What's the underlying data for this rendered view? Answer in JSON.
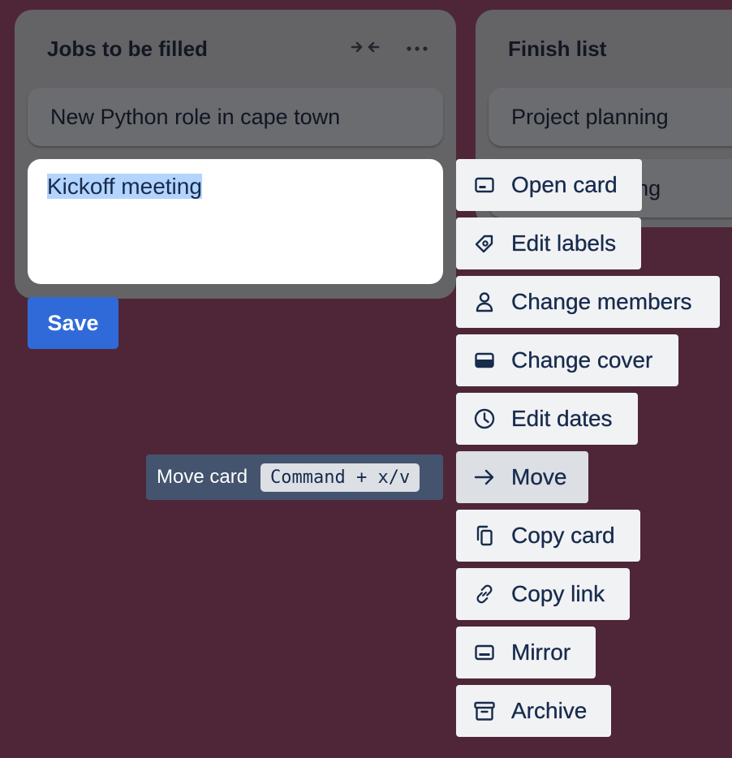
{
  "lists": [
    {
      "title": "Jobs to be filled",
      "cards": [
        "New Python role in cape town"
      ]
    },
    {
      "title": "Finish list",
      "cards": [
        "Project planning",
        "Kickoff meeting"
      ]
    }
  ],
  "editor": {
    "text": "Kickoff meeting",
    "save_label": "Save"
  },
  "tooltip": {
    "label": "Move card",
    "shortcut": "Command + x/v"
  },
  "menu": {
    "items": [
      {
        "label": "Open card",
        "icon": "card-icon"
      },
      {
        "label": "Edit labels",
        "icon": "tag-icon"
      },
      {
        "label": "Change members",
        "icon": "person-icon"
      },
      {
        "label": "Change cover",
        "icon": "cover-icon"
      },
      {
        "label": "Edit dates",
        "icon": "clock-icon"
      },
      {
        "label": "Move",
        "icon": "arrow-right-icon"
      },
      {
        "label": "Copy card",
        "icon": "copy-icon"
      },
      {
        "label": "Copy link",
        "icon": "link-icon"
      },
      {
        "label": "Mirror",
        "icon": "mirror-icon"
      },
      {
        "label": "Archive",
        "icon": "archive-icon"
      }
    ]
  },
  "colors": {
    "board_background": "#4e2638",
    "save_button": "#2f6ad8",
    "menu_button": "#f1f2f4",
    "text": "#172b4d"
  }
}
